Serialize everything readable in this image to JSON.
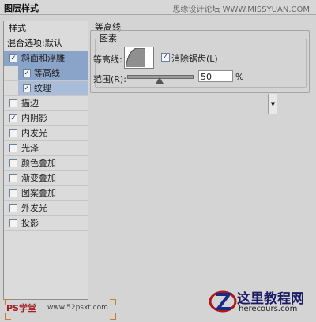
{
  "window": {
    "title": "图层样式",
    "watermark": "思缘设计论坛 WWW.MISSYUAN.COM"
  },
  "left_panel": {
    "header": "样式",
    "blend_options": "混合选项:默认",
    "items": [
      {
        "label": "斜面和浮雕",
        "checked": true
      },
      {
        "label": "等高线",
        "checked": true
      },
      {
        "label": "纹理",
        "checked": true
      },
      {
        "label": "描边",
        "checked": false
      },
      {
        "label": "内阴影",
        "checked": true
      },
      {
        "label": "内发光",
        "checked": false
      },
      {
        "label": "光泽",
        "checked": false
      },
      {
        "label": "颜色叠加",
        "checked": false
      },
      {
        "label": "渐变叠加",
        "checked": false
      },
      {
        "label": "图案叠加",
        "checked": false
      },
      {
        "label": "外发光",
        "checked": false
      },
      {
        "label": "投影",
        "checked": false
      }
    ]
  },
  "contour_panel": {
    "title": "等高线",
    "section": "图素",
    "contour_label": "等高线:",
    "antialias_label": "消除锯齿(L)",
    "antialias_checked": true,
    "range_label": "范围(R):",
    "range_value": "50",
    "range_unit": "%",
    "range_fraction": 0.5
  },
  "checkmark": "✓",
  "dropdown_arrow": "▼",
  "footer": {
    "wm_left": "PS学堂",
    "wm_left_url": "www.52psxt.com",
    "logo_name": "这里教程网",
    "logo_url": "herecours.com"
  },
  "colors": {
    "selection": "#8aa3c8",
    "subselection": "#a9bcd9"
  }
}
